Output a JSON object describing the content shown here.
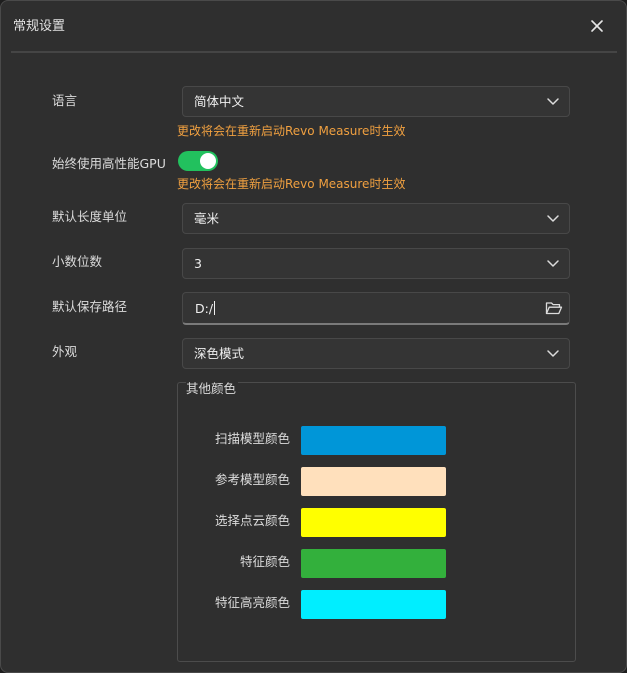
{
  "window": {
    "title": "常规设置",
    "close_icon": "close-icon"
  },
  "settings": {
    "language": {
      "label": "语言",
      "value": "简体中文",
      "hint": "更改将会在重新启动Revo Measure时生效"
    },
    "gpu": {
      "label": "始终使用高性能GPU",
      "enabled": true,
      "hint": "更改将会在重新启动Revo Measure时生效"
    },
    "length_unit": {
      "label": "默认长度单位",
      "value": "毫米"
    },
    "decimals": {
      "label": "小数位数",
      "value": "3"
    },
    "save_path": {
      "label": "默认保存路径",
      "value": "D:/",
      "icon": "folder-open-icon"
    },
    "appearance": {
      "label": "外观",
      "value": "深色模式"
    }
  },
  "colors": {
    "group_title": "其他颜色",
    "items": [
      {
        "label": "扫描模型颜色",
        "color": "#0096d8"
      },
      {
        "label": "参考模型颜色",
        "color": "#ffe0bc"
      },
      {
        "label": "选择点云颜色",
        "color": "#ffff00"
      },
      {
        "label": "特征颜色",
        "color": "#33b03c"
      },
      {
        "label": "特征高亮颜色",
        "color": "#00eeff"
      }
    ]
  },
  "theme": {
    "background": "#2f2f2f",
    "hint_color": "#f0a040",
    "toggle_on": "#22c15e"
  }
}
